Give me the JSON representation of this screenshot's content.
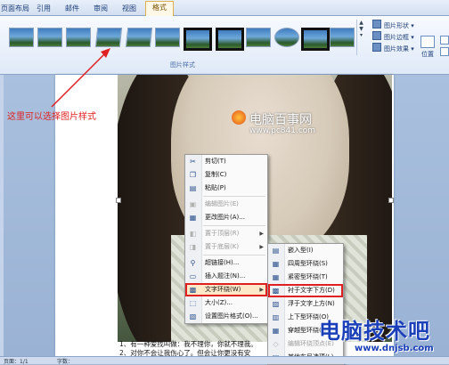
{
  "ribbon": {
    "tabs": [
      {
        "label": "页面布局",
        "active": false
      },
      {
        "label": "引用",
        "active": false
      },
      {
        "label": "邮件",
        "active": false
      },
      {
        "label": "审阅",
        "active": false
      },
      {
        "label": "视图",
        "active": false
      },
      {
        "label": "格式",
        "active": true
      }
    ],
    "group_label": "图片样式",
    "side_commands": [
      "图片形状",
      "图片边框",
      "图片效果"
    ],
    "position_label": "位置"
  },
  "annotation": {
    "note": "这里可以选择图片样式"
  },
  "photo": {
    "watermark_cn": "电脑百事网",
    "watermark_url": "www.pc841.com"
  },
  "context_menu": {
    "items": [
      {
        "label": "剪切(T)",
        "icon": "scissors-icon",
        "disabled": false
      },
      {
        "label": "复制(C)",
        "icon": "copy-icon",
        "disabled": false
      },
      {
        "label": "粘贴(P)",
        "icon": "paste-icon",
        "disabled": false
      },
      {
        "label": "编辑图片(E)",
        "icon": "edit-picture-icon",
        "disabled": true
      },
      {
        "label": "更改图片(A)...",
        "icon": "change-picture-icon",
        "disabled": false
      },
      {
        "label": "置于顶层(R)",
        "icon": "bring-front-icon",
        "disabled": true,
        "submenu": true
      },
      {
        "label": "置于底层(K)",
        "icon": "send-back-icon",
        "disabled": true,
        "submenu": true
      },
      {
        "label": "超链接(H)...",
        "icon": "hyperlink-icon",
        "disabled": false
      },
      {
        "label": "插入题注(N)...",
        "icon": "caption-icon",
        "disabled": false
      },
      {
        "label": "文字环绕(W)",
        "icon": "text-wrap-icon",
        "disabled": false,
        "submenu": true,
        "highlighted": true
      },
      {
        "label": "大小(Z)...",
        "icon": "size-icon",
        "disabled": false
      },
      {
        "label": "设置图片格式(O)...",
        "icon": "format-picture-icon",
        "disabled": false
      }
    ]
  },
  "wrap_submenu": {
    "items": [
      {
        "label": "嵌入型(I)",
        "highlighted": false,
        "disabled": false
      },
      {
        "label": "四周型环绕(S)",
        "highlighted": false,
        "disabled": false
      },
      {
        "label": "紧密型环绕(T)",
        "highlighted": false,
        "disabled": false
      },
      {
        "label": "衬于文字下方(D)",
        "highlighted": true,
        "disabled": false
      },
      {
        "label": "浮于文字上方(N)",
        "highlighted": false,
        "disabled": false
      },
      {
        "label": "上下型环绕(O)",
        "highlighted": false,
        "disabled": false
      },
      {
        "label": "穿越型环绕(H)",
        "highlighted": false,
        "disabled": false
      },
      {
        "label": "编辑环绕顶点(E)",
        "highlighted": false,
        "disabled": true
      },
      {
        "label": "其他布局选项(L)...",
        "highlighted": false,
        "disabled": false
      }
    ]
  },
  "document": {
    "line1": "1、有一种爱找叫做：我不理你，你就不理我。",
    "line2": "2、对你不会让我伤心了。但会让你更没有安"
  },
  "site_watermark": {
    "cn": "电脑技术吧",
    "url": "www.dnjsb.com"
  },
  "status_bar": {
    "left": "页面：1/1",
    "mid": "字数："
  }
}
